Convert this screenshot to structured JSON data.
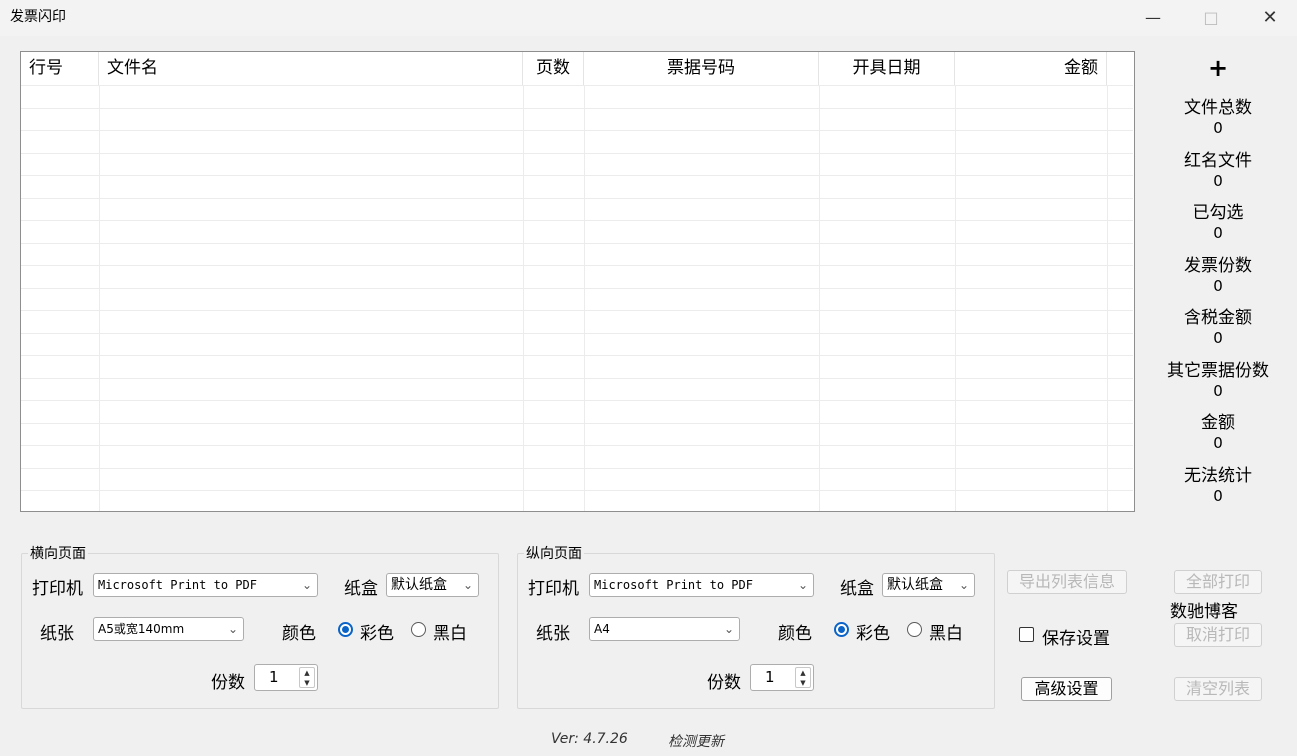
{
  "window": {
    "title": "发票闪印"
  },
  "table": {
    "columns": [
      "行号",
      "文件名",
      "页数",
      "票据号码",
      "开具日期",
      "金额"
    ]
  },
  "stats": {
    "plus": "+",
    "items": [
      {
        "label": "文件总数",
        "value": "0"
      },
      {
        "label": "红名文件",
        "value": "0"
      },
      {
        "label": "已勾选",
        "value": "0"
      },
      {
        "label": "发票份数",
        "value": "0"
      },
      {
        "label": "含税金额",
        "value": "0"
      },
      {
        "label": "其它票据份数",
        "value": "0"
      },
      {
        "label": "金额",
        "value": "0"
      },
      {
        "label": "无法统计",
        "value": "0"
      }
    ]
  },
  "landscape": {
    "title": "横向页面",
    "printer_label": "打印机",
    "printer_value": "Microsoft Print to PDF",
    "tray_label": "纸盒",
    "tray_value": "默认纸盒",
    "paper_label": "纸张",
    "paper_value": "A5或宽140mm",
    "color_label": "颜色",
    "color_option": "彩色",
    "bw_option": "黑白",
    "copies_label": "份数",
    "copies_value": "1"
  },
  "portrait": {
    "title": "纵向页面",
    "printer_label": "打印机",
    "printer_value": "Microsoft Print to PDF",
    "tray_label": "纸盒",
    "tray_value": "默认纸盒",
    "paper_label": "纸张",
    "paper_value": "A4",
    "color_label": "颜色",
    "color_option": "彩色",
    "bw_option": "黑白",
    "copies_label": "份数",
    "copies_value": "1"
  },
  "actions": {
    "export": "导出列表信息",
    "save_settings": "保存设置",
    "advanced": "高级设置",
    "print_all": "全部打印",
    "brand": "数驰博客",
    "cancel_print": "取消打印",
    "clear_list": "清空列表"
  },
  "footer": {
    "version": "Ver: 4.7.26",
    "check_update": "检测更新"
  }
}
